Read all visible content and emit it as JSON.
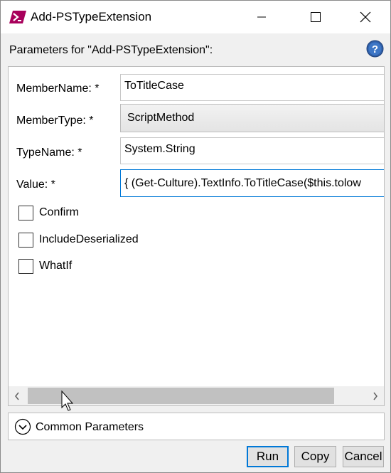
{
  "window": {
    "title": "Add-PSTypeExtension",
    "minimize_icon": "minimize-icon",
    "maximize_icon": "maximize-icon",
    "close_icon": "close-icon",
    "app_icon": "powershell-icon"
  },
  "header": {
    "params_label": "Parameters for \"Add-PSTypeExtension\":",
    "help_icon": "help-icon"
  },
  "form": {
    "member_name": {
      "label": "MemberName: *",
      "value": "ToTitleCase"
    },
    "member_type": {
      "label": "MemberType: *",
      "value": "ScriptMethod"
    },
    "type_name": {
      "label": "TypeName: *",
      "value": "System.String"
    },
    "value": {
      "label": "Value: *",
      "value": "{ (Get-Culture).TextInfo.ToTitleCase($this.tolow"
    },
    "checkboxes": [
      {
        "label": "Confirm",
        "checked": false
      },
      {
        "label": "IncludeDeserialized",
        "checked": false
      },
      {
        "label": "WhatIf",
        "checked": false
      }
    ]
  },
  "scrollbar": {
    "left_arrow": "chevron-left-icon",
    "right_arrow": "chevron-right-icon"
  },
  "common_parameters": {
    "label": "Common Parameters",
    "icon": "chevron-down-circle-icon"
  },
  "buttons": {
    "run": "Run",
    "copy": "Copy",
    "cancel": "Cancel"
  },
  "colors": {
    "accent": "#0078d7",
    "powershell_icon": "#a8005b",
    "help_icon": "#2f5fa8"
  }
}
